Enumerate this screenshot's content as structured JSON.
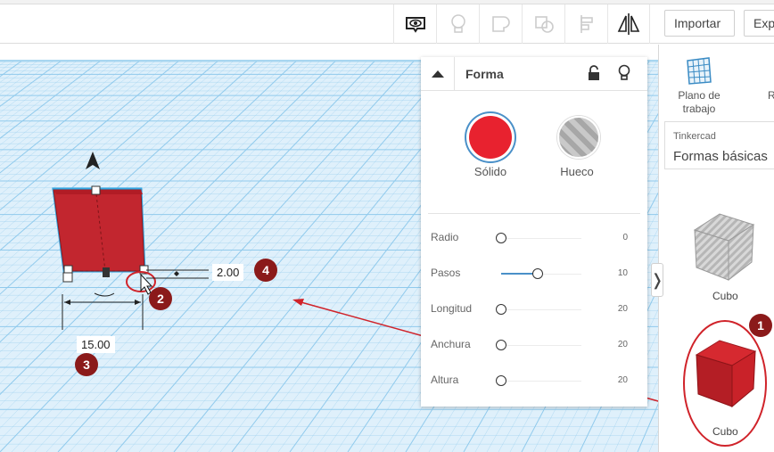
{
  "toolbar": {
    "import_label": "Importar",
    "export_label": "Exp",
    "tools": [
      "visibility-icon",
      "bulb-icon",
      "group-icon",
      "ungroup-icon",
      "align-icon",
      "mirror-icon"
    ]
  },
  "inspector": {
    "title": "Forma",
    "solid_label": "Sólido",
    "hole_label": "Hueco",
    "solid_color": "#e8222f",
    "params": [
      {
        "label": "Radio",
        "value": "0",
        "fraction": 0.0
      },
      {
        "label": "Pasos",
        "value": "10",
        "fraction": 0.45
      },
      {
        "label": "Longitud",
        "value": "20",
        "fraction": 0.0
      },
      {
        "label": "Anchura",
        "value": "20",
        "fraction": 0.0
      },
      {
        "label": "Altura",
        "value": "20",
        "fraction": 0.0
      }
    ]
  },
  "side_panel": {
    "workplane_label": "Plano de trabajo",
    "ruler_label": "R",
    "library_small": "Tinkercad",
    "library_name": "Formas básicas",
    "shapes": [
      {
        "label": "Cubo",
        "kind": "hole"
      },
      {
        "label": "Cubo",
        "kind": "solid"
      }
    ]
  },
  "workplane": {
    "dim_width": "15.00",
    "dim_height": "2.00"
  },
  "annotations": [
    "1",
    "2",
    "3",
    "4"
  ],
  "colors": {
    "grid_bg": "#dff0fb",
    "grid_line": "#8dc9ec",
    "shape_red": "#c2262f",
    "arrow": "#d0232a",
    "badge": "#8b1a1a"
  }
}
